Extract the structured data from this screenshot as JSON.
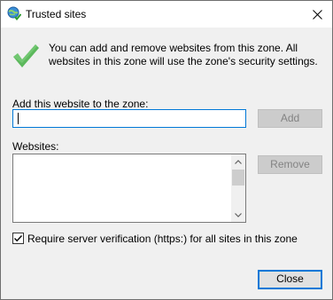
{
  "window": {
    "title": "Trusted sites",
    "icon": "globe-check-icon",
    "close_icon": "close-icon"
  },
  "info": {
    "icon": "green-checkmark-icon",
    "accent_color": "#5cb85c",
    "text": "You can add and remove websites from this zone. All websites in this zone will use the zone's security settings."
  },
  "add_site": {
    "label": "Add this website to the zone:",
    "value": "",
    "button_label": "Add"
  },
  "websites": {
    "label": "Websites:",
    "items": [],
    "remove_label": "Remove"
  },
  "verification": {
    "label": "Require server verification (https:) for all sites in this zone",
    "checked": true
  },
  "footer": {
    "close_label": "Close"
  }
}
